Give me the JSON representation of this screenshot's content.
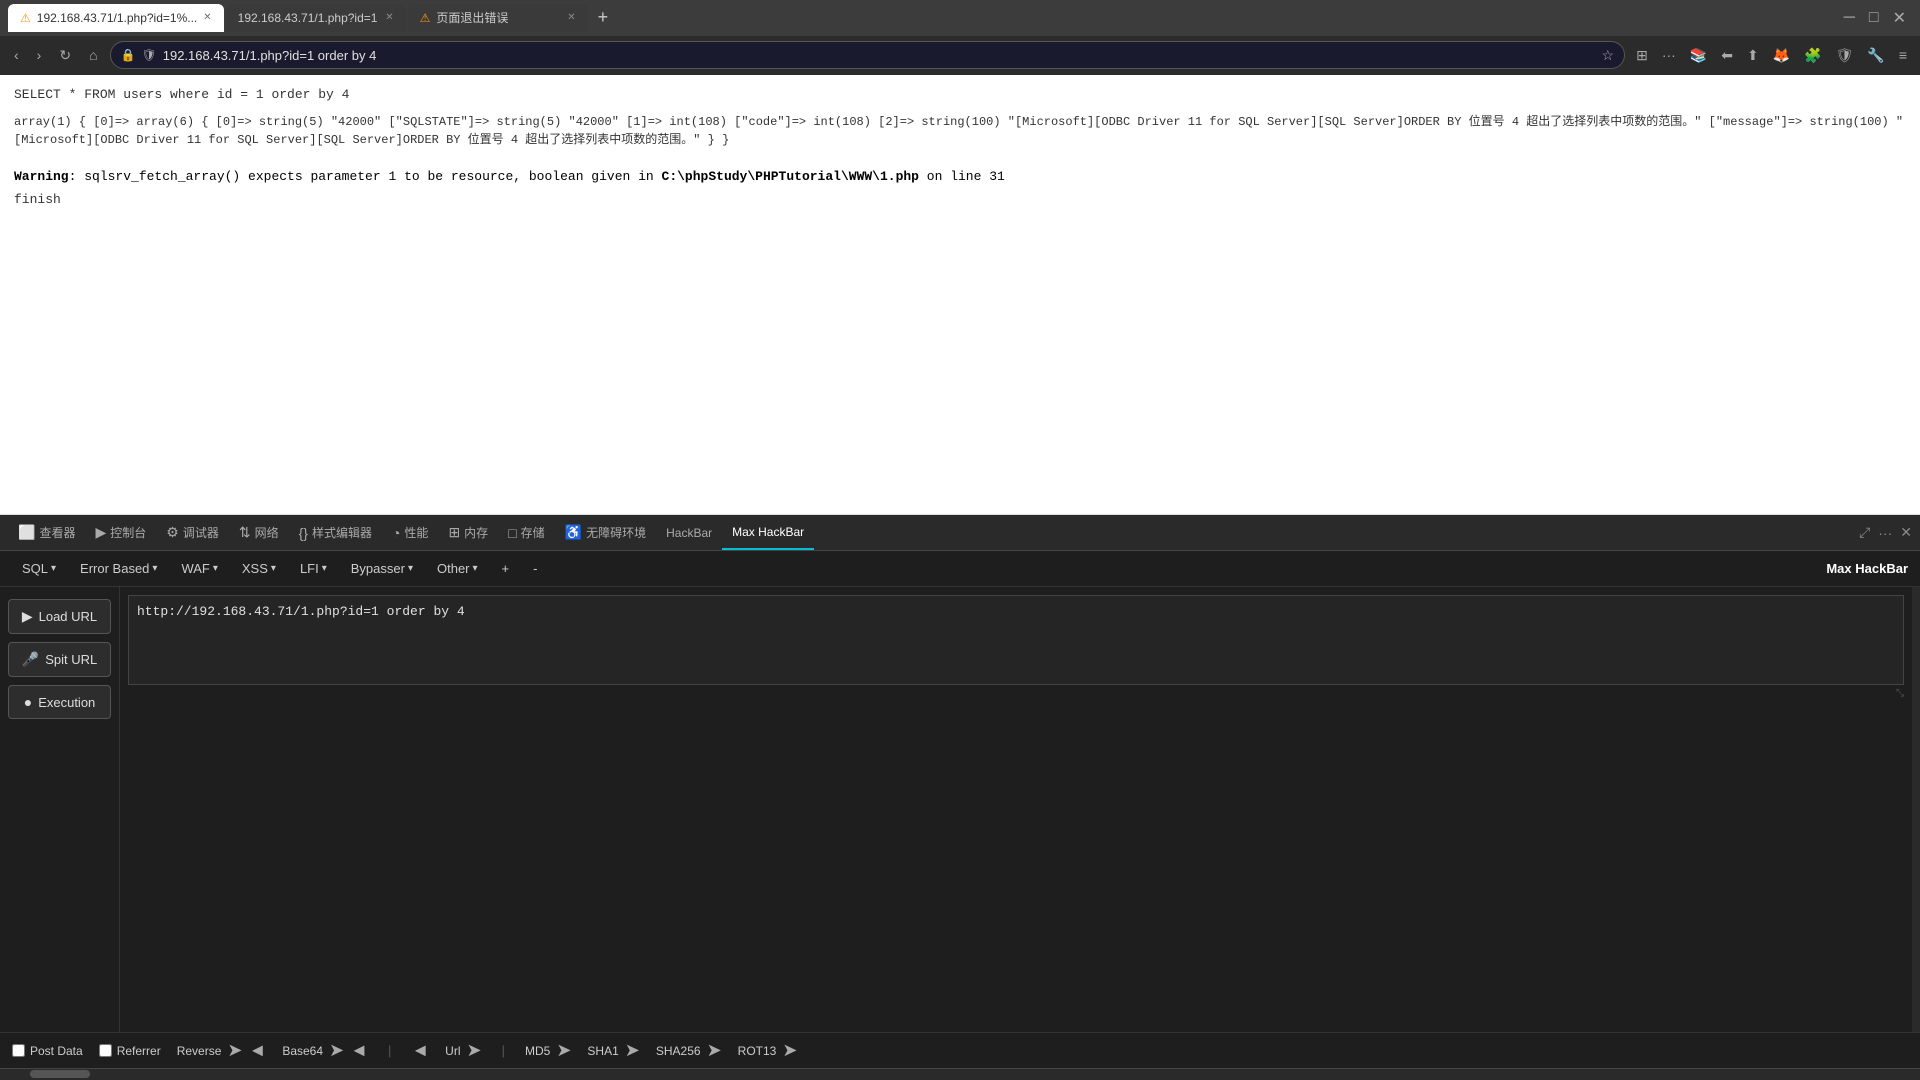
{
  "browser": {
    "tabs": [
      {
        "id": "tab1",
        "title": "192.168.43.71/1.php?id=1%...",
        "url": "192.168.43.71/1.php?id=1%...",
        "active": true,
        "warning": true
      },
      {
        "id": "tab2",
        "title": "192.168.43.71/1.php?id=1",
        "url": "192.168.43.71/1.php?id=1",
        "active": false,
        "warning": false
      },
      {
        "id": "tab3",
        "title": "页面退出错误",
        "url": "",
        "active": false,
        "warning": true
      }
    ],
    "url": "192.168.43.71/1.php?id=1 order by 4",
    "new_tab_label": "+"
  },
  "page": {
    "sql_query": "SELECT * FROM users where id = 1 order by 4",
    "array_output": "array(1) { [0]=> array(6) { [0]=> string(5) \"42000\" [\"SQLSTATE\"]=> string(5) \"42000\" [1]=> int(108) [\"code\"]=> int(108) [2]=> string(100) \"[Microsoft][ODBC Driver 11 for SQL Server][SQL Server]ORDER BY 位置号 4 超出了选择列表中项数的范围。\" [\"message\"]=> string(100) \"[Microsoft][ODBC Driver 11 for SQL Server][SQL Server]ORDER BY 位置号 4 超出了选择列表中项数的范围。\" } }",
    "warning_label": "Warning",
    "warning_text": ": sqlsrv_fetch_array() expects parameter 1 to be resource, boolean given in",
    "warning_path": "C:\\phpStudy\\PHPTutorial\\WWW\\1.php",
    "warning_line": "on line 31",
    "finish_text": "finish"
  },
  "devtools": {
    "tools": [
      {
        "id": "inspector",
        "label": "查看器",
        "icon": "⬜"
      },
      {
        "id": "console",
        "label": "控制台",
        "icon": ">"
      },
      {
        "id": "debugger",
        "label": "调试器",
        "icon": "⚙"
      },
      {
        "id": "network",
        "label": "网络",
        "icon": "⇅"
      },
      {
        "id": "style",
        "label": "样式编辑器",
        "icon": "{}"
      },
      {
        "id": "performance",
        "label": "性能",
        "icon": "◔"
      },
      {
        "id": "memory",
        "label": "内存",
        "icon": "⊞"
      },
      {
        "id": "storage",
        "label": "存储",
        "icon": "□"
      },
      {
        "id": "accessibility",
        "label": "无障碍环境",
        "icon": "♿"
      },
      {
        "id": "hackbar",
        "label": "HackBar",
        "icon": ""
      },
      {
        "id": "maxhackbar",
        "label": "Max HackBar",
        "icon": "",
        "active": true
      }
    ]
  },
  "hackbar": {
    "title": "Max HackBar",
    "menu": [
      {
        "id": "sql",
        "label": "SQL",
        "has_arrow": true
      },
      {
        "id": "error-based",
        "label": "Error Based",
        "has_arrow": true
      },
      {
        "id": "waf",
        "label": "WAF",
        "has_arrow": true
      },
      {
        "id": "xss",
        "label": "XSS",
        "has_arrow": true
      },
      {
        "id": "lfi",
        "label": "LFI",
        "has_arrow": true
      },
      {
        "id": "bypasser",
        "label": "Bypasser",
        "has_arrow": true
      },
      {
        "id": "other",
        "label": "Other",
        "has_arrow": true
      },
      {
        "id": "plus",
        "label": "+"
      },
      {
        "id": "minus",
        "label": "-"
      }
    ],
    "buttons": [
      {
        "id": "load-url",
        "label": "Load URL",
        "icon": "▶"
      },
      {
        "id": "spit-url",
        "label": "Spit URL",
        "icon": "🎤"
      },
      {
        "id": "execution",
        "label": "Execution",
        "icon": "●"
      }
    ],
    "url_input": "http://192.168.43.71/1.php?id=1 order by 4",
    "url_placeholder": "http://192.168.43.71/1.php?id=1 order by 4",
    "options": {
      "post_data_label": "Post Data",
      "referrer_label": "Referrer",
      "reverse_label": "Reverse",
      "base64_label": "Base64",
      "url_label": "Url",
      "md5_label": "MD5",
      "sha1_label": "SHA1",
      "sha256_label": "SHA256",
      "rot13_label": "ROT13"
    }
  }
}
